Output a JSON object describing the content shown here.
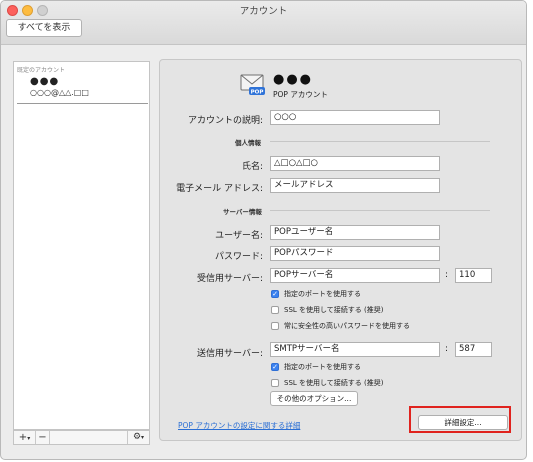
{
  "window": {
    "title": "アカウント"
  },
  "toolbar": {
    "show_all_label": "すべてを表示"
  },
  "sidebar": {
    "header": "既定のアカウント",
    "account_name": "●●●",
    "account_email": "○○○@△△.□□",
    "add_label": "+",
    "remove_label": "−",
    "gear_label": "⚙"
  },
  "account": {
    "name": "●●●",
    "type": "POP アカウント",
    "description_label": "アカウントの説明:",
    "description_value": "○○○"
  },
  "personal": {
    "section_label": "個人情報",
    "name_label": "氏名:",
    "name_value": "△□○△□○",
    "email_label": "電子メール アドレス:",
    "email_value": "メールアドレス"
  },
  "server": {
    "section_label": "サーバー情報",
    "username_label": "ユーザー名:",
    "username_value": "POPユーザー名",
    "password_label": "パスワード:",
    "password_value": "POPパスワード",
    "incoming_label": "受信用サーバー:",
    "incoming_value": "POPサーバー名",
    "incoming_port": "110",
    "incoming_options": [
      {
        "label": "指定のポートを使用する",
        "checked": true
      },
      {
        "label": "SSL を使用して接続する (推奨)",
        "checked": false
      },
      {
        "label": "常に安全性の高いパスワードを使用する",
        "checked": false
      }
    ],
    "outgoing_label": "送信用サーバー:",
    "outgoing_value": "SMTPサーバー名",
    "outgoing_port": "587",
    "outgoing_options": [
      {
        "label": "指定のポートを使用する",
        "checked": true
      },
      {
        "label": "SSL を使用して接続する (推奨)",
        "checked": false
      }
    ],
    "more_options_label": "その他のオプション..."
  },
  "footer": {
    "help_link": "POP アカウントの設定に関する詳細",
    "advanced_label": "詳細設定..."
  },
  "colors": {
    "accent": "#3b82f0",
    "link": "#2a6ed4",
    "highlight": "#e0231e"
  },
  "icons": {
    "mail": "envelope-pop-icon",
    "gear": "gear-icon"
  }
}
